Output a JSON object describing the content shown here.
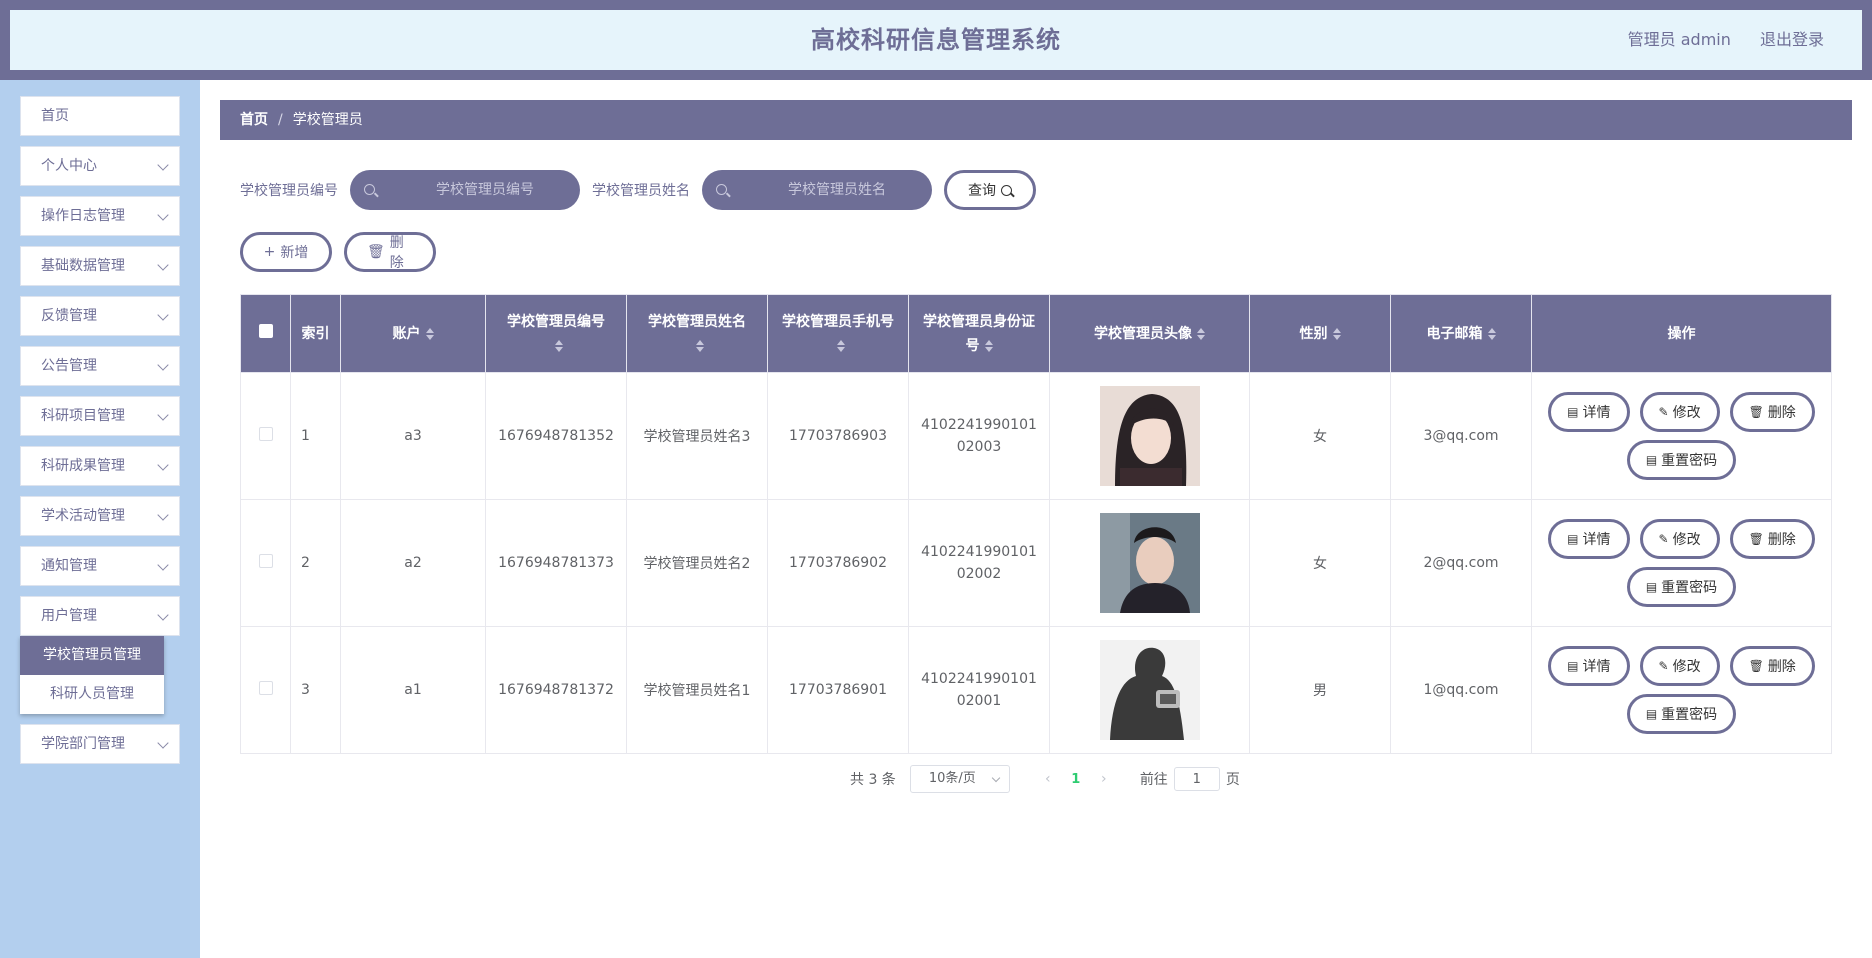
{
  "header": {
    "title": "高校科研信息管理系统",
    "user": "管理员 admin",
    "logout": "退出登录"
  },
  "sidebar": {
    "items": [
      {
        "label": "首页",
        "expandable": false
      },
      {
        "label": "个人中心",
        "expandable": true
      },
      {
        "label": "操作日志管理",
        "expandable": true
      },
      {
        "label": "基础数据管理",
        "expandable": true
      },
      {
        "label": "反馈管理",
        "expandable": true
      },
      {
        "label": "公告管理",
        "expandable": true
      },
      {
        "label": "科研项目管理",
        "expandable": true
      },
      {
        "label": "科研成果管理",
        "expandable": true
      },
      {
        "label": "学术活动管理",
        "expandable": true
      },
      {
        "label": "通知管理",
        "expandable": true
      },
      {
        "label": "用户管理",
        "expandable": true
      },
      {
        "label": "学院部门管理",
        "expandable": true
      }
    ],
    "submenu": [
      {
        "label": "学校管理员管理",
        "active": true
      },
      {
        "label": "科研人员管理",
        "active": false
      }
    ]
  },
  "breadcrumb": {
    "home": "首页",
    "separator": "/",
    "current": "学校管理员"
  },
  "search": {
    "field1_label": "学校管理员编号",
    "field1_placeholder": "学校管理员编号",
    "field2_label": "学校管理员姓名",
    "field2_placeholder": "学校管理员姓名",
    "query_label": "查询"
  },
  "actions": {
    "add_label": "新增",
    "delete_label": "删除"
  },
  "table": {
    "headers": {
      "index": "索引",
      "account": "账户",
      "number": "学校管理员编号",
      "name": "学校管理员姓名",
      "phone": "学校管理员手机号",
      "idcard": "学校管理员身份证号",
      "avatar": "学校管理员头像",
      "gender": "性别",
      "email": "电子邮箱",
      "ops": "操作"
    },
    "rows": [
      {
        "index": "1",
        "account": "a3",
        "number": "1676948781352",
        "name": "学校管理员姓名3",
        "phone": "17703786903",
        "idcard": "410224199010102003",
        "gender": "女",
        "email": "3@qq.com"
      },
      {
        "index": "2",
        "account": "a2",
        "number": "1676948781373",
        "name": "学校管理员姓名2",
        "phone": "17703786902",
        "idcard": "410224199010102002",
        "gender": "女",
        "email": "2@qq.com"
      },
      {
        "index": "3",
        "account": "a1",
        "number": "1676948781372",
        "name": "学校管理员姓名1",
        "phone": "17703786901",
        "idcard": "410224199010102001",
        "gender": "男",
        "email": "1@qq.com"
      }
    ],
    "op_labels": {
      "detail": "详情",
      "edit": "修改",
      "delete": "删除",
      "reset": "重置密码"
    }
  },
  "pagination": {
    "total": "共 3 条",
    "page_size": "10条/页",
    "current_page": "1",
    "goto_label": "前往",
    "goto_value": "1",
    "page_suffix": "页"
  },
  "colors": {
    "primary": "#6e6e96",
    "header_bg": "#e6f4fb",
    "sidebar_bg": "#b3cfee",
    "active_page": "#2ecc71"
  }
}
